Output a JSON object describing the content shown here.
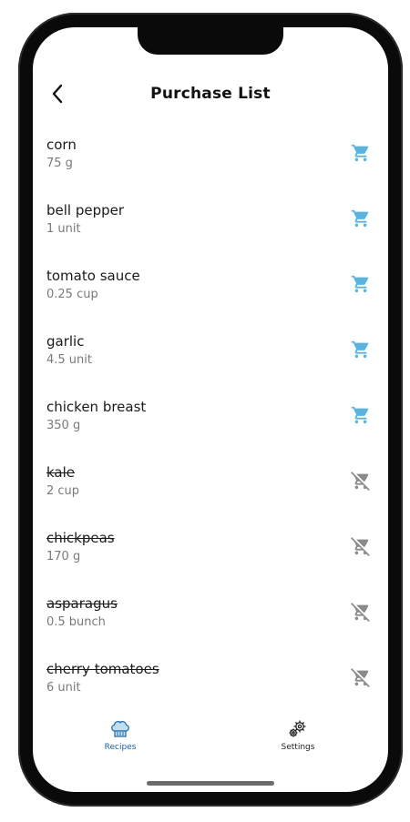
{
  "header": {
    "back_icon": "chevron-left-icon",
    "title": "Purchase List"
  },
  "colors": {
    "cart_active": "#5AB5DD",
    "cart_done": "#8a8a8a",
    "nav_active": "#1f5f9e"
  },
  "items": [
    {
      "name": "corn",
      "qty": "75 g",
      "purchased": false
    },
    {
      "name": "bell pepper",
      "qty": "1 unit",
      "purchased": false
    },
    {
      "name": "tomato sauce",
      "qty": "0.25 cup",
      "purchased": false
    },
    {
      "name": "garlic",
      "qty": "4.5 unit",
      "purchased": false
    },
    {
      "name": "chicken breast",
      "qty": "350 g",
      "purchased": false
    },
    {
      "name": "kale",
      "qty": "2 cup",
      "purchased": true
    },
    {
      "name": "chickpeas",
      "qty": "170 g",
      "purchased": true
    },
    {
      "name": "asparagus",
      "qty": "0.5 bunch",
      "purchased": true
    },
    {
      "name": "cherry tomatoes",
      "qty": "6 unit",
      "purchased": true
    }
  ],
  "nav": {
    "recipes": {
      "label": "Recipes",
      "icon": "chef-hat-icon",
      "active": true
    },
    "settings": {
      "label": "Settings",
      "icon": "gears-icon",
      "active": false
    }
  }
}
